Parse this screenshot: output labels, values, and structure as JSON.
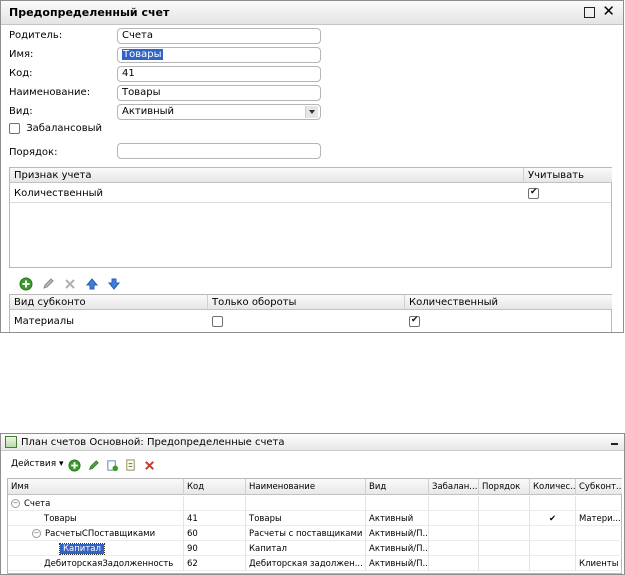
{
  "dialog": {
    "title": "Предопределенный счет",
    "labels": {
      "parent": "Родитель:",
      "name": "Имя:",
      "code": "Код:",
      "naming": "Наименование:",
      "kind": "Вид:",
      "offbalance": "Забалансовый",
      "order": "Порядок:"
    },
    "values": {
      "parent": "Счета",
      "name": "Товары",
      "code": "41",
      "naming": "Товары",
      "kind": "Активный",
      "order": ""
    },
    "offbalance_checked": false,
    "attr_table": {
      "headers": [
        "Признак учета",
        "Учитывать"
      ],
      "rows": [
        {
          "name": "Количественный",
          "checked": true
        }
      ]
    },
    "subconto_table": {
      "headers": [
        "Вид субконто",
        "Только обороты",
        "Количественный"
      ],
      "rows": [
        {
          "name": "Материалы",
          "turnover_only": false,
          "quantitative": true
        }
      ]
    }
  },
  "list_window": {
    "title": "План счетов Основной: Предопределенные счета",
    "actions_label": "Действия ▾",
    "headers": [
      "Имя",
      "Код",
      "Наименование",
      "Вид",
      "Забалан...",
      "Порядок",
      "Количес...",
      "Субконт..."
    ],
    "rows": [
      {
        "name": "Счета",
        "code": "",
        "naming": "",
        "kind": "",
        "check": "",
        "subconto": ""
      },
      {
        "name": "Товары",
        "code": "41",
        "naming": "Товары",
        "kind": "Активный",
        "check": "✔",
        "subconto": "Матери..."
      },
      {
        "name": "РасчетыСПоставщиками",
        "code": "60",
        "naming": "Расчеты с поставщиками",
        "kind": "Активный/П...",
        "check": "",
        "subconto": ""
      },
      {
        "name": "Капитал",
        "code": "90",
        "naming": "Капитал",
        "kind": "Активный/П...",
        "check": "",
        "subconto": ""
      },
      {
        "name": "ДебиторскаяЗадолженность",
        "code": "62",
        "naming": "Дебиторская задолжен...",
        "kind": "Активный/П...",
        "check": "",
        "subconto": "Клиенты"
      }
    ]
  },
  "colors": {
    "selection": "#3163c7",
    "add_icon": "#3a9a2a",
    "delete_icon": "#cc3a2a",
    "arrow_icon": "#3f7ed8"
  }
}
